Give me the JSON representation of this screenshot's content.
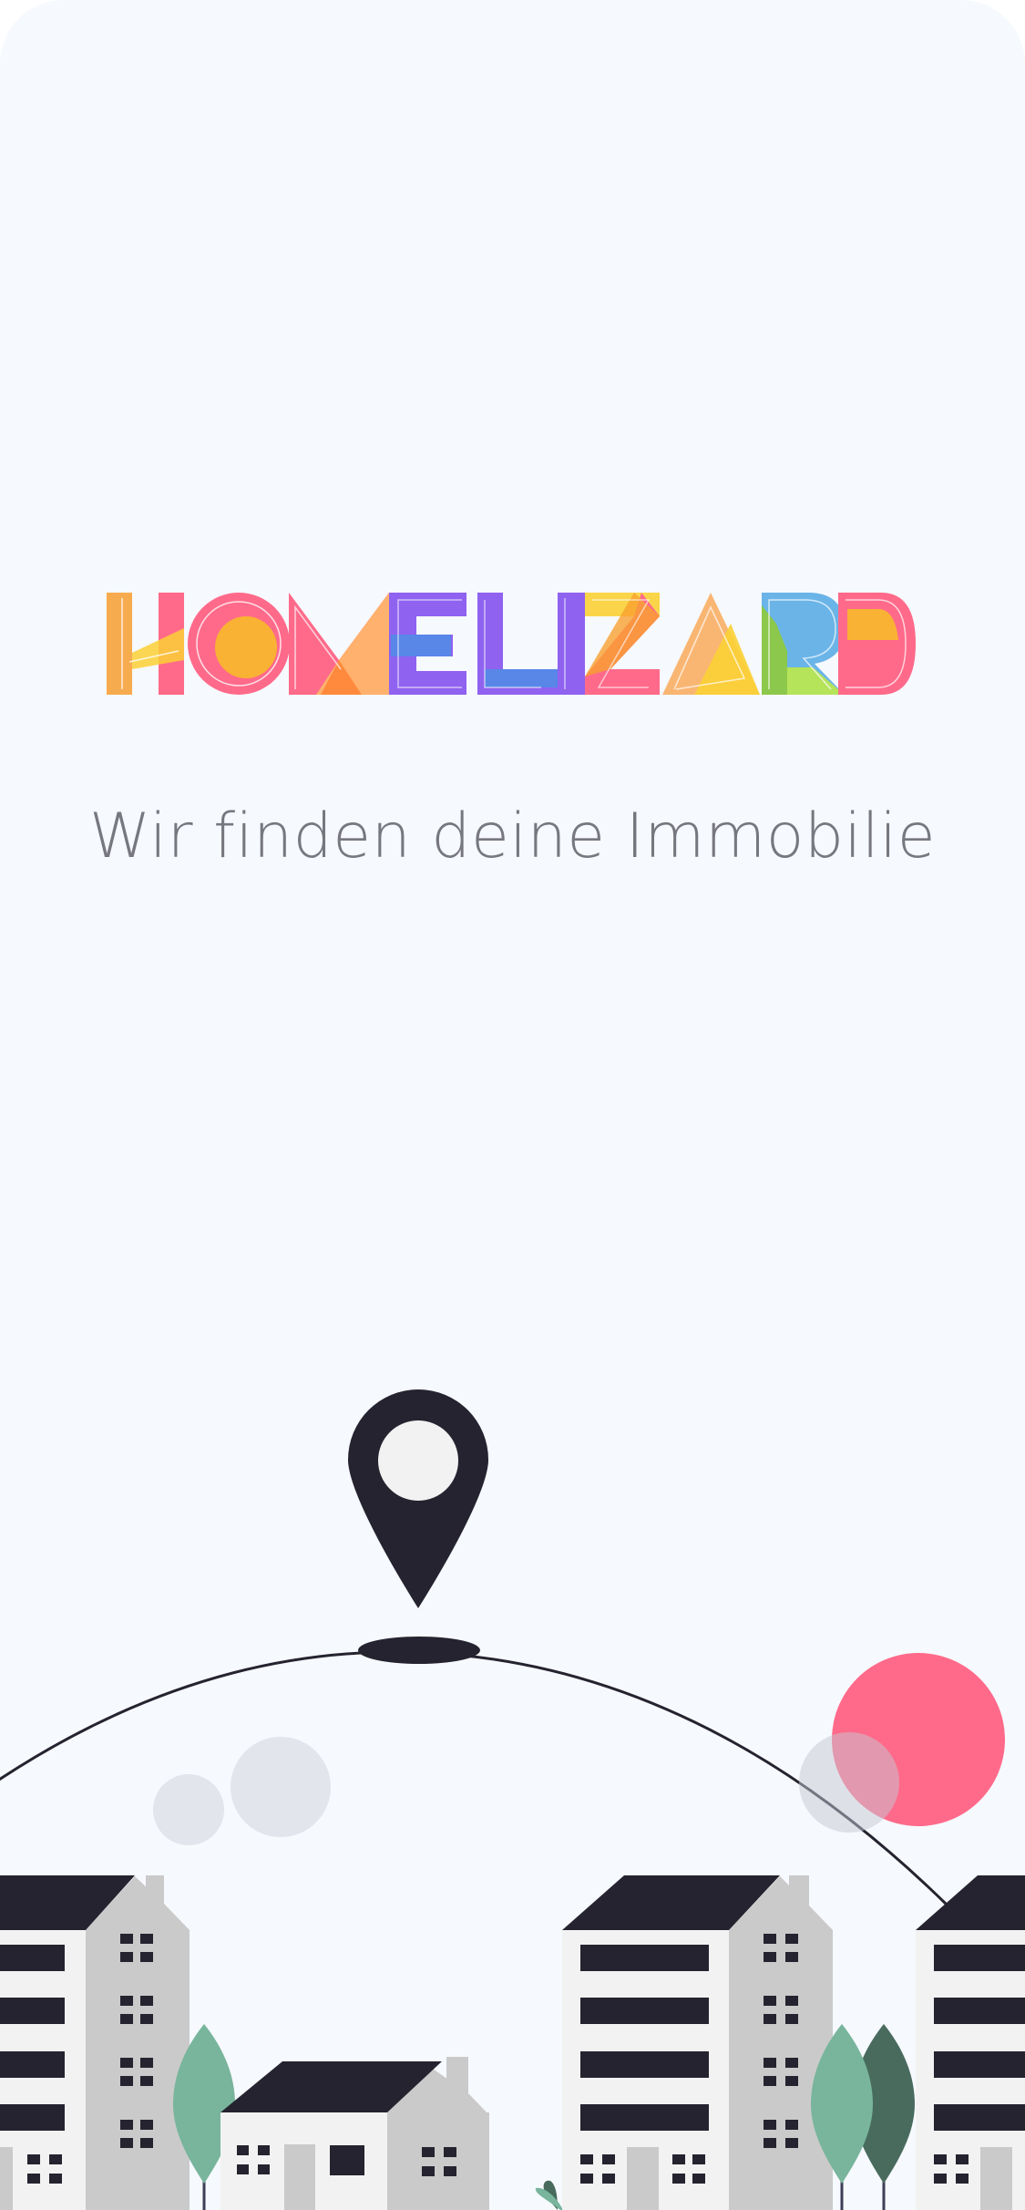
{
  "app": {
    "brand_name": "HOMELIZARD",
    "tagline": "Wir finden deine Immobilie"
  },
  "logo_letters": [
    {
      "char": "H",
      "colors": [
        "#f9a8b8",
        "#ff6a8a",
        "#fbd035"
      ]
    },
    {
      "char": "O",
      "colors": [
        "#ff6a8a",
        "#f9b233"
      ]
    },
    {
      "char": "M",
      "colors": [
        "#ff6a8a",
        "#ffb56b",
        "#ff8a3d"
      ]
    },
    {
      "char": "E",
      "colors": [
        "#8f62f0",
        "#4f8ee6"
      ]
    },
    {
      "char": "L",
      "colors": [
        "#8f62f0",
        "#4f8ee6"
      ]
    },
    {
      "char": "I",
      "colors": [
        "#8f62f0"
      ]
    },
    {
      "char": "Z",
      "colors": [
        "#fbd035",
        "#f9a030",
        "#ff6a8a"
      ]
    },
    {
      "char": "A",
      "colors": [
        "#f9b26b",
        "#fbd035"
      ]
    },
    {
      "char": "R",
      "colors": [
        "#6ab4e8",
        "#8cc84b",
        "#b5e35a"
      ]
    },
    {
      "char": "D",
      "colors": [
        "#ff6a8a",
        "#f9b233"
      ]
    }
  ],
  "illustration": {
    "marker_icon": "map-pin-icon",
    "colors": {
      "dark": "#25232f",
      "building_light": "#f2f2f2",
      "building_shade": "#cacaca",
      "tree_light": "#78b59c",
      "tree_dark": "#486b5e",
      "sun": "#ff6a8a",
      "bubble": "#e2e5ec",
      "background": "#f6f9fd"
    }
  }
}
